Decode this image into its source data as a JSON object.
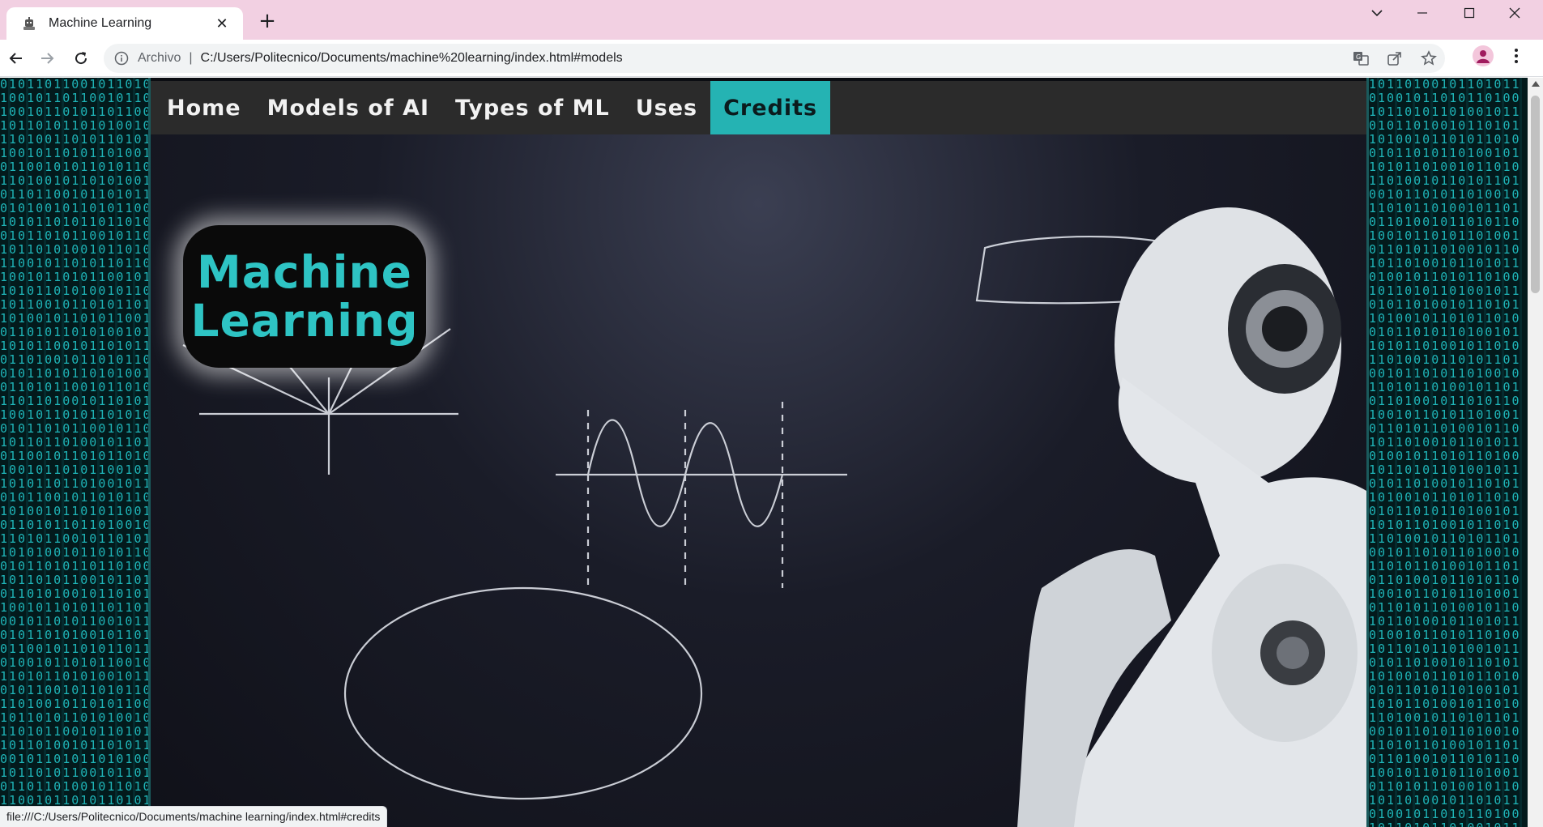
{
  "browser": {
    "tab_title": "Machine Learning",
    "tab_close": "✕",
    "new_tab": "+",
    "address_scheme": "Archivo",
    "address_separator": "|",
    "address_url": "C:/Users/Politecnico/Documents/machine%20learning/index.html#models",
    "status_url": "file:///C:/Users/Politecnico/Documents/machine learning/index.html#credits"
  },
  "nav": {
    "items": [
      {
        "label": "Home"
      },
      {
        "label": "Models of AI"
      },
      {
        "label": "Types of ML"
      },
      {
        "label": "Uses"
      },
      {
        "label": "Credits",
        "active": true
      }
    ]
  },
  "logo": {
    "line1": "Machine",
    "line2": "Learning"
  },
  "matrix": {
    "left": "0101101100101101010010110110010110100101101011011001011010110101001011010011010110101100101101011010010110010101101011011010010110101001011011001011010110101001011010110010101101011011010010110101100101101011010100101101011001011010110110100101101011001011010110101001011010110010110101101101001011010110010110101101010010110101100101101011011010010110101100101101011010100101101011001011010110110100101101011001011010110101001011010110010110101101101001011010110010110101101010010110101100101101011011010010110101100101101011010100101101011001011010110110100101101011001011010110101001011010110010110101101101001011010110010110101101010010110101100101101011011010010110101100101101011010100101101011001011010110110100101101011001011010110101001011010110010110101101101001011010110010110101101010010110101100101101011011010010110101100101101011010100101101011001011010110110100101101011001011010110101001011010110010110101101101001011010110010110101101010010110101100101101011011010010110101100101101011010100101101011001011010110110100101101011001011010110101001011010110010110101101101001011010110010110",
    "right": "1011010010110101101001011010110100101101011010010110101101001011010110100101101011010010110101101001011010110100101101011010010110101101001011010110100101101011010010110101101001011010110100101101011010010110101101001011010110100101101011010010110101101001011010110100101101011010010110101101001011010110100101101011010010110101101001011010110100101101011010010110101101001011010110100101101011010010110101101001011010110100101101011010010110101101001011010110100101101011010010110101101001011010110100101101011010010110101101001011010110100101101011010010110101101001011010110100101101011010010110101101001011010110100101101011010010110101101001011010110100101101011010010110101101001011010110100101101011010010110101101001011010110100101101011010010110101101001011010110100101101011010010110101101001011010110100101101011010010110101101001011010110100101101011010010110101101001011010110100101101011010010110101101001011010110100101101011010010110101101001011010110100101101011010010110101101001011010110100101101011010010110101101001011010110100101101011010010110101101001"
  },
  "colors": {
    "accent": "#25b3b3",
    "logo_text": "#2ec4c4",
    "nav_bg": "#2b2b2b",
    "tabstrip_bg": "#f2d0e2"
  },
  "icons": {
    "favicon": "robot-icon",
    "back": "arrow-left-icon",
    "forward": "arrow-right-icon",
    "reload": "reload-icon",
    "info": "info-icon",
    "translate": "translate-icon",
    "share": "share-icon",
    "bookmark": "star-icon",
    "profile": "profile-icon",
    "menu": "kebab-menu-icon"
  }
}
